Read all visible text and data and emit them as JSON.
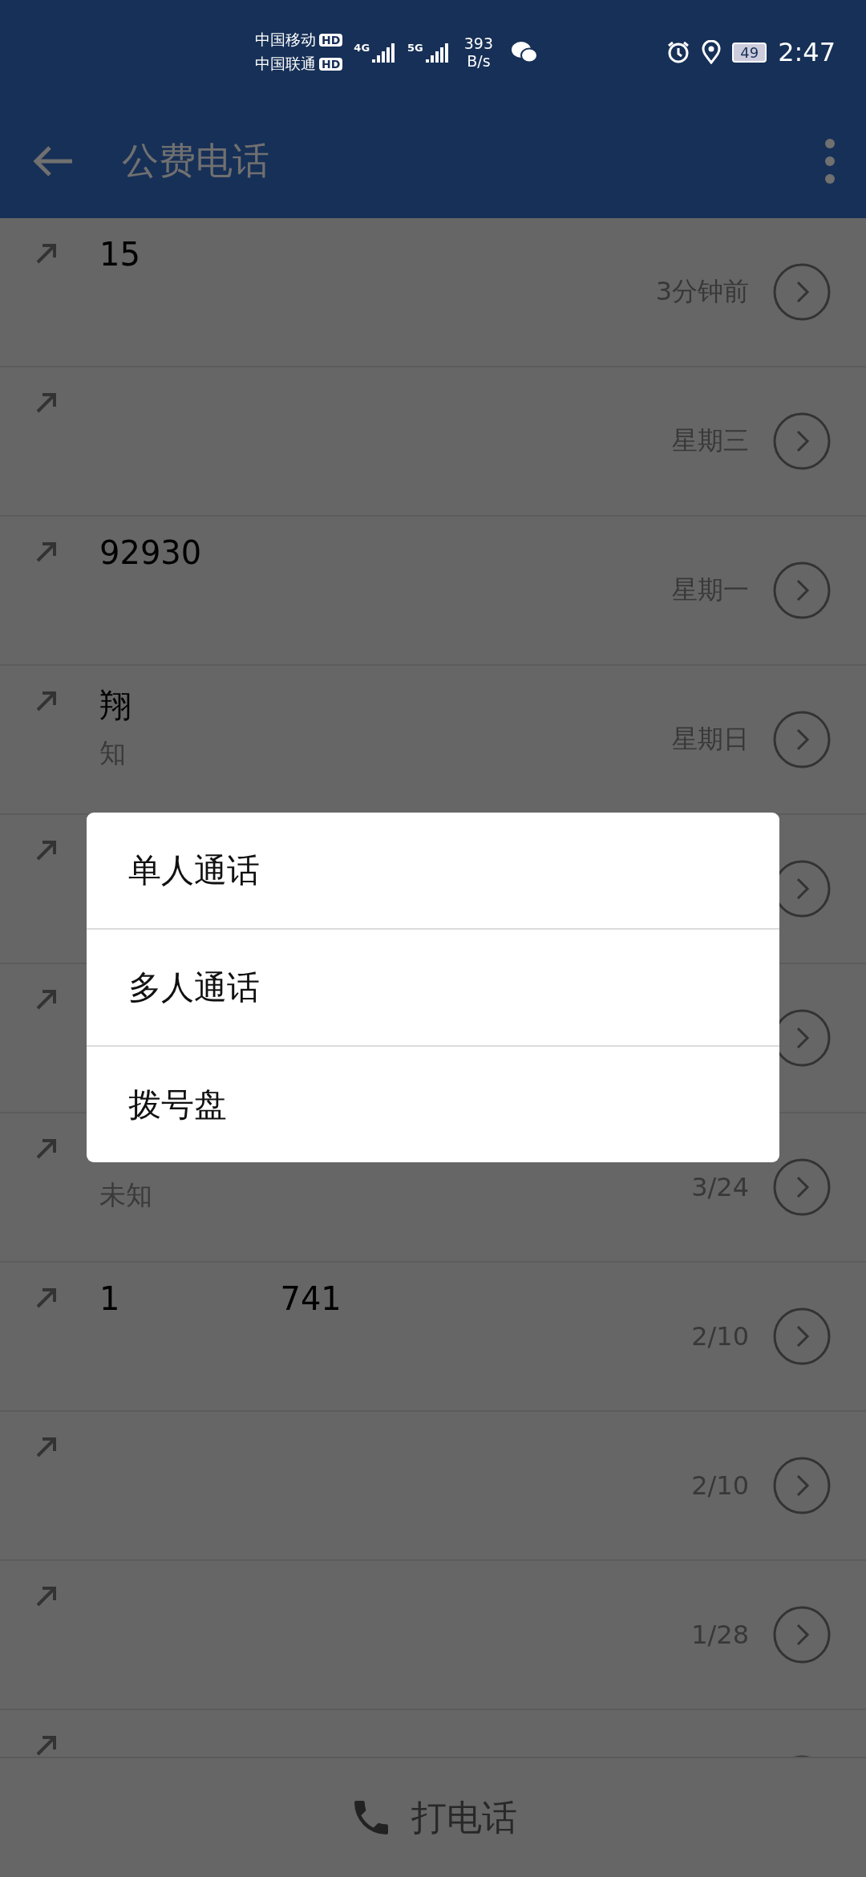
{
  "status_bar": {
    "carriers": [
      {
        "name": "中国移动",
        "badge": "HD",
        "network": "4G"
      },
      {
        "name": "中国联通",
        "badge": "HD",
        "network": "5G"
      }
    ],
    "speed_value": "393",
    "speed_unit": "B/s",
    "battery": "49",
    "time": "2:47"
  },
  "header": {
    "title": "公费电话"
  },
  "calls": [
    {
      "kind": "outgoing",
      "name": "15",
      "time": "3分钟前"
    },
    {
      "kind": "outgoing",
      "time": "星期三"
    },
    {
      "kind": "outgoing",
      "name": "92930",
      "time": "星期一"
    },
    {
      "kind": "outgoing",
      "name": "翔",
      "subtitle": "知",
      "time": "星期日"
    },
    {
      "kind": "outgoing"
    },
    {
      "kind": "outgoing"
    },
    {
      "kind": "outgoing",
      "subtitle": "未知",
      "time": "3/24"
    },
    {
      "kind": "outgoing",
      "name": "1",
      "name_tail": "741",
      "time": "2/10"
    },
    {
      "kind": "outgoing",
      "time": "2/10"
    },
    {
      "kind": "outgoing",
      "time": "1/28"
    },
    {
      "kind": "outgoing"
    }
  ],
  "menu": {
    "options": [
      "单人通话",
      "多人通话",
      "拨号盘"
    ]
  },
  "bottom_bar": {
    "label": "打电话"
  }
}
